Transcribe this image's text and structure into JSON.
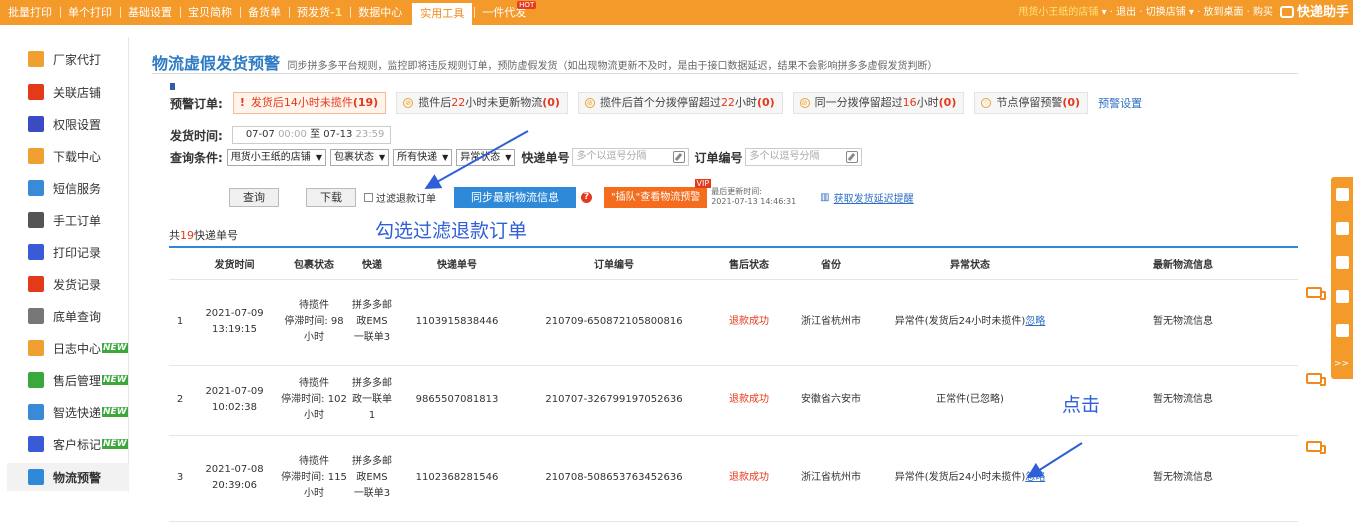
{
  "topnav": {
    "items": [
      "批量打印",
      "单个打印",
      "基础设置",
      "宝贝简称",
      "备货单",
      "预发货",
      "数据中心",
      "实用工具",
      "一件代发"
    ],
    "prefetch_count": "-1",
    "hot_badge": "HOT",
    "active_index": 7
  },
  "topright": {
    "store": "甩货小王纸的店铺",
    "logout": "退出",
    "switch_store": "切换店铺",
    "desktop": "放到桌面",
    "buy": "购买",
    "logo": "快递助手"
  },
  "sidebar": {
    "items": [
      {
        "label": "厂家代打",
        "icon": "factory-icon",
        "color": "#f0a030"
      },
      {
        "label": "关联店铺",
        "icon": "dice-icon",
        "color": "#e4391b"
      },
      {
        "label": "权限设置",
        "icon": "lock-icon",
        "color": "#3a4bc4"
      },
      {
        "label": "下载中心",
        "icon": "download-icon",
        "color": "#f0a030"
      },
      {
        "label": "短信服务",
        "icon": "sms-icon",
        "color": "#3a8ad8"
      },
      {
        "label": "手工订单",
        "icon": "keyboard-icon",
        "color": "#555555"
      },
      {
        "label": "打印记录",
        "icon": "print-record-icon",
        "color": "#3a5bd8"
      },
      {
        "label": "发货记录",
        "icon": "ship-record-icon",
        "color": "#e4391b"
      },
      {
        "label": "底单查询",
        "icon": "receipt-icon",
        "color": "#777777"
      },
      {
        "label": "日志中心",
        "icon": "log-icon",
        "color": "#f0a030",
        "badge": "NEW"
      },
      {
        "label": "售后管理",
        "icon": "aftersale-icon",
        "color": "#3aa83a",
        "badge": "NEW"
      },
      {
        "label": "智选快递",
        "icon": "smart-express-icon",
        "color": "#3a8ad8",
        "badge": "NEW"
      },
      {
        "label": "客户标记",
        "icon": "customer-icon",
        "color": "#3a5bd8",
        "badge": "NEW"
      },
      {
        "label": "物流预警",
        "icon": "logistics-warning-icon",
        "color": "#2e8ad8"
      }
    ],
    "active_index": 13
  },
  "page": {
    "title": "物流虚假发货预警",
    "description": "同步拼多多平台规则，监控即将违反规则订单，预防虚假发货（如出现物流更新不及时，是由于接口数据延迟，结果不会影响拼多多虚假发货判断）"
  },
  "warnings": {
    "label": "预警订单:",
    "items": [
      {
        "pre": "发货后",
        "num": "14",
        "post": "小时未揽件",
        "count": "(19)"
      },
      {
        "pre": "揽件后",
        "num": "22",
        "post": "小时未更新物流",
        "count": "(0)"
      },
      {
        "pre": "揽件后首个分拨停留超过",
        "num": "22",
        "post": "小时",
        "count": "(0)"
      },
      {
        "pre": "同一分拨停留超过",
        "num": "16",
        "post": "小时",
        "count": "(0)"
      },
      {
        "pre": "节点停留预警",
        "num": "",
        "post": "",
        "count": "(0)"
      }
    ],
    "settings_link": "预警设置"
  },
  "time": {
    "label": "发货时间:",
    "start_date": "07-07",
    "start_time": "00:00",
    "to": "至",
    "end_date": "07-13",
    "end_time": "23:59"
  },
  "query": {
    "label": "查询条件:",
    "selects": [
      "甩货小王纸的店铺",
      "包裹状态",
      "所有快递",
      "异常状态"
    ],
    "express_label": "快递单号",
    "express_placeholder": "多个以逗号分隔",
    "order_label": "订单编号",
    "order_placeholder": "多个以逗号分隔"
  },
  "actions": {
    "query": "查询",
    "download": "下载",
    "filter_refund": "过滤退款订单",
    "sync": "同步最新物流信息",
    "queue_check": "\"插队\"查看物流预警",
    "vip": "VIP",
    "last_update_label": "最后更新时间:",
    "last_update_time": "2021-07-13 14:46:31",
    "get_delay_reminder": "获取发货延迟提醒"
  },
  "annotations": {
    "filter_hint": "勾选过滤退款订单",
    "click_hint": "点击"
  },
  "summary": {
    "prefix": "共",
    "count": "19",
    "suffix": "快递单号"
  },
  "table": {
    "headers": [
      "",
      "发货时间",
      "包裹状态",
      "快递",
      "快递单号",
      "订单编号",
      "售后状态",
      "省份",
      "异常状态",
      "最新物流信息"
    ],
    "rows": [
      {
        "index": "1",
        "date": "2021-07-09",
        "time": "13:19:15",
        "status": "待揽件",
        "stay": "停滞时间: 98小时",
        "express": "拼多多邮政EMS一联单3",
        "tracking": "1103915838446",
        "order": "210709-650872105800816",
        "aftersale": "退款成功",
        "province": "浙江省杭州市",
        "abnormal": "异常件(发货后24小时未揽件)",
        "ignore": "忽略",
        "latest": "暂无物流信息"
      },
      {
        "index": "2",
        "date": "2021-07-09",
        "time": "10:02:38",
        "status": "待揽件",
        "stay": "停滞时间: 102小时",
        "express": "拼多多邮政一联单1",
        "tracking": "9865507081813",
        "order": "210707-326799197052636",
        "aftersale": "退款成功",
        "province": "安徽省六安市",
        "abnormal": "正常件(已忽略)",
        "ignore": "",
        "latest": "暂无物流信息"
      },
      {
        "index": "3",
        "date": "2021-07-08",
        "time": "20:39:06",
        "status": "待揽件",
        "stay": "停滞时间: 115小时",
        "express": "拼多多邮政EMS一联单3",
        "tracking": "1102368281546",
        "order": "210708-508653763452636",
        "aftersale": "退款成功",
        "province": "浙江省杭州市",
        "abnormal": "异常件(发货后24小时未揽件)",
        "ignore": "忽略",
        "latest": "暂无物流信息"
      }
    ]
  },
  "right_float": {
    "label": ">>"
  }
}
